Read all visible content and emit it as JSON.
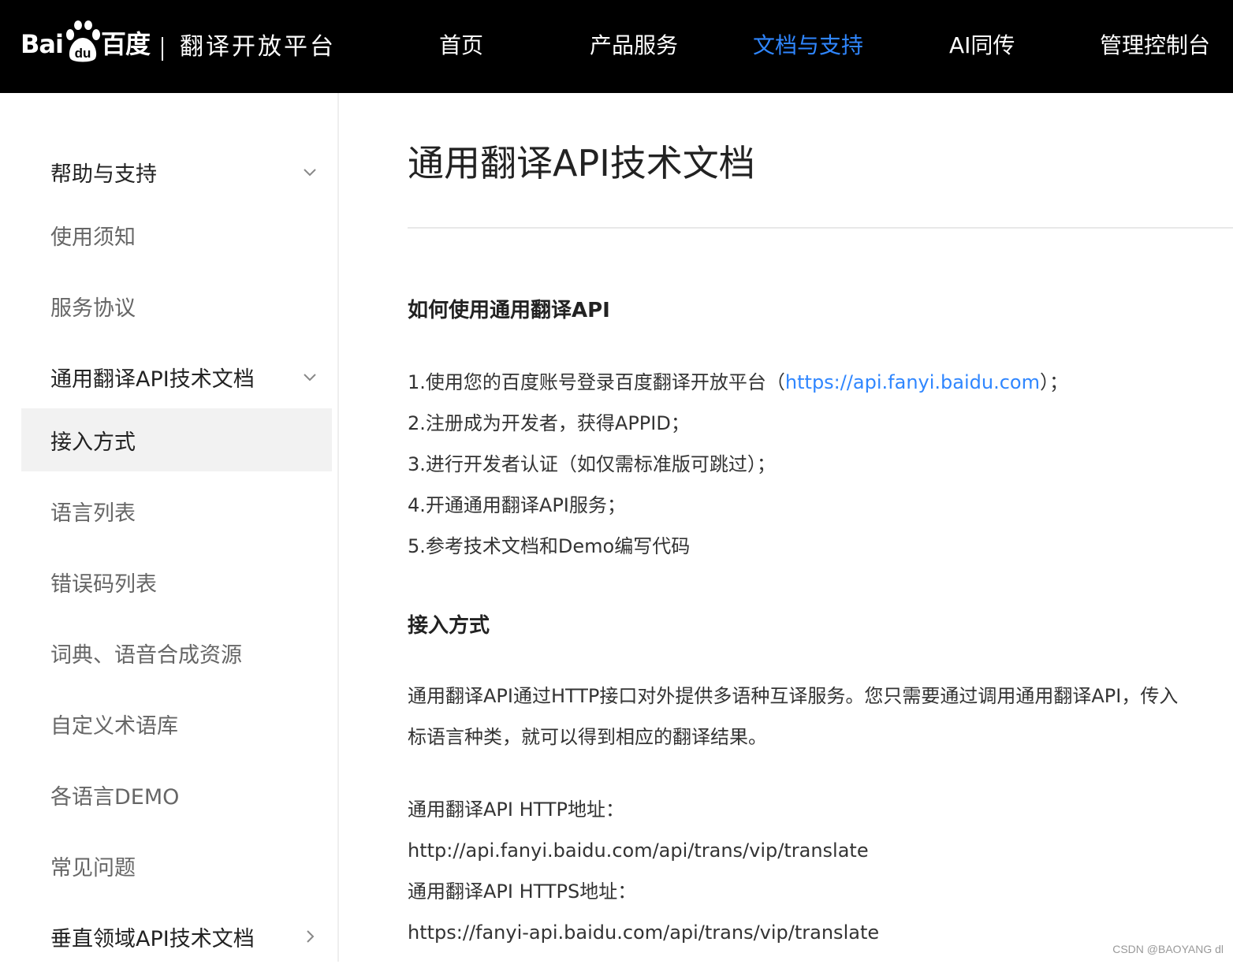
{
  "header": {
    "logo_bai": "Bai",
    "logo_du": "百度",
    "logo_paw_text": "du",
    "platform": "翻译开放平台",
    "nav": [
      {
        "label": "首页",
        "active": false
      },
      {
        "label": "产品服务",
        "active": false
      },
      {
        "label": "文档与支持",
        "active": true
      },
      {
        "label": "AI同传",
        "active": false
      },
      {
        "label": "管理控制台",
        "active": false
      }
    ]
  },
  "sidebar": {
    "items": [
      {
        "label": "帮助与支持",
        "type": "group",
        "chevron": "down"
      },
      {
        "label": "使用须知",
        "type": "item"
      },
      {
        "label": "服务协议",
        "type": "item"
      },
      {
        "label": "通用翻译API技术文档",
        "type": "group",
        "chevron": "down"
      },
      {
        "label": "接入方式",
        "type": "item",
        "selected": true
      },
      {
        "label": "语言列表",
        "type": "item"
      },
      {
        "label": "错误码列表",
        "type": "item"
      },
      {
        "label": "词典、语音合成资源",
        "type": "item"
      },
      {
        "label": "自定义术语库",
        "type": "item"
      },
      {
        "label": "各语言DEMO",
        "type": "item"
      },
      {
        "label": "常见问题",
        "type": "item"
      },
      {
        "label": "垂直领域API技术文档",
        "type": "group",
        "chevron": "right"
      }
    ]
  },
  "main": {
    "title": "通用翻译API技术文档",
    "section1": {
      "heading": "如何使用通用翻译API",
      "steps": {
        "step1_prefix": "1.使用您的百度账号登录百度翻译开放平台（",
        "step1_link": "https://api.fanyi.baidu.com",
        "step1_suffix": "）；",
        "step2": "2.注册成为开发者，获得APPID；",
        "step3": "3.进行开发者认证（如仅需标准版可跳过）；",
        "step4": "4.开通通用翻译API服务；",
        "step5": "5.参考技术文档和Demo编写代码"
      }
    },
    "section2": {
      "heading": "接入方式",
      "para_line1": "通用翻译API通过HTTP接口对外提供多语种互译服务。您只需要通过调用通用翻译API，传入",
      "para_line2": "标语言种类，就可以得到相应的翻译结果。",
      "http_label": "通用翻译API HTTP地址：",
      "http_url": "http://api.fanyi.baidu.com/api/trans/vip/translate",
      "https_label": "通用翻译API HTTPS地址：",
      "https_url": "https://fanyi-api.baidu.com/api/trans/vip/translate"
    }
  },
  "watermark": "CSDN @BAOYANG dl",
  "colors": {
    "topbar_bg": "#000000",
    "accent": "#2f86ff",
    "selected_bg": "#f2f2f2"
  }
}
